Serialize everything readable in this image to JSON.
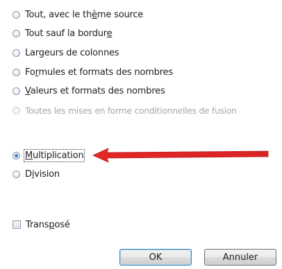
{
  "options": [
    {
      "pre": "Tout, avec le th",
      "acc": "è",
      "post": "me source",
      "enabled": true,
      "checked": false
    },
    {
      "pre": "Tout sauf la bordur",
      "acc": "e",
      "post": "",
      "enabled": true,
      "checked": false
    },
    {
      "pre": "Lar",
      "acc": "g",
      "post": "eurs de colonnes",
      "enabled": true,
      "checked": false
    },
    {
      "pre": "Fo",
      "acc": "r",
      "post": "mules et formats des nombres",
      "enabled": true,
      "checked": false
    },
    {
      "pre": "",
      "acc": "V",
      "post": "aleurs et formats des nombres",
      "enabled": true,
      "checked": false
    },
    {
      "pre": "Toutes les mises en forme conditionnelles de fusion",
      "acc": "",
      "post": "",
      "enabled": false,
      "checked": false
    }
  ],
  "operations": [
    {
      "pre": "",
      "acc": "M",
      "post": "ultiplication",
      "checked": true
    },
    {
      "pre": "D",
      "acc": "i",
      "post": "vision",
      "checked": false
    }
  ],
  "transpose": {
    "pre": "Trans",
    "acc": "p",
    "post": "osé",
    "checked": false
  },
  "buttons": {
    "ok": "OK",
    "cancel": "Annuler"
  },
  "colors": {
    "arrow": "#e31c1c",
    "focus_button_border": "#3c7fb1"
  },
  "icons": {
    "arrow": "red-arrow-icon",
    "radio": "radio-button-icon",
    "checkbox": "checkbox-icon"
  }
}
